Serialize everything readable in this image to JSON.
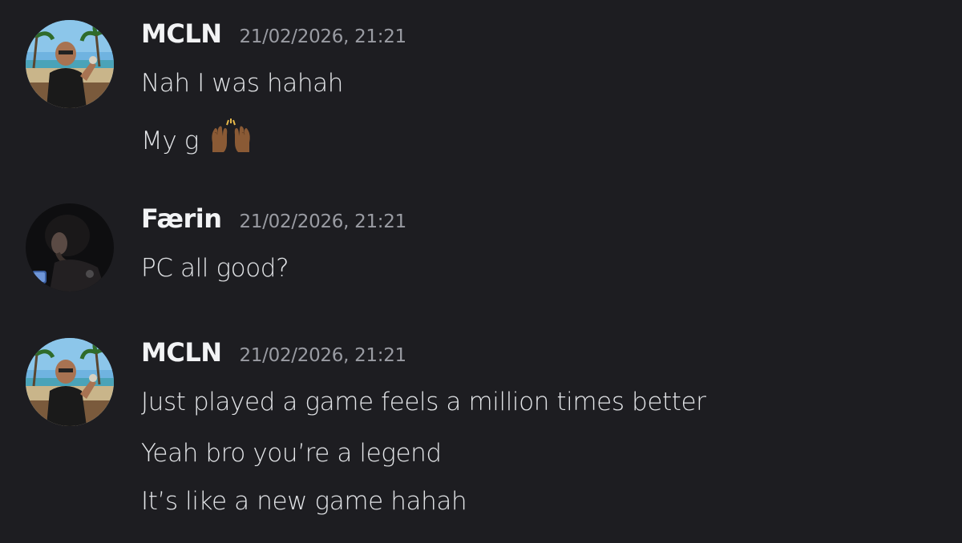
{
  "messages": [
    {
      "author": "MCLN",
      "timestamp": "21/02/2026, 21:21",
      "avatar": "beach-selfie-avatar",
      "lines": [
        "Nah I was hahah",
        "My g"
      ],
      "emoji": "raising-hands-emoji"
    },
    {
      "author": "Færin",
      "timestamp": "21/02/2026, 21:21",
      "avatar": "dark-portrait-avatar",
      "lines": [
        "PC all good?"
      ]
    },
    {
      "author": "MCLN",
      "timestamp": "21/02/2026, 21:21",
      "avatar": "beach-selfie-avatar",
      "lines": [
        "Just played a game feels a million times better",
        "Yeah bro you’re a legend",
        "It’s like a new game hahah"
      ]
    }
  ],
  "colors": {
    "background": "#1d1d21",
    "username": "#f2f3f5",
    "timestamp": "#9a9ca3",
    "message_text": "#e3e5e8"
  }
}
